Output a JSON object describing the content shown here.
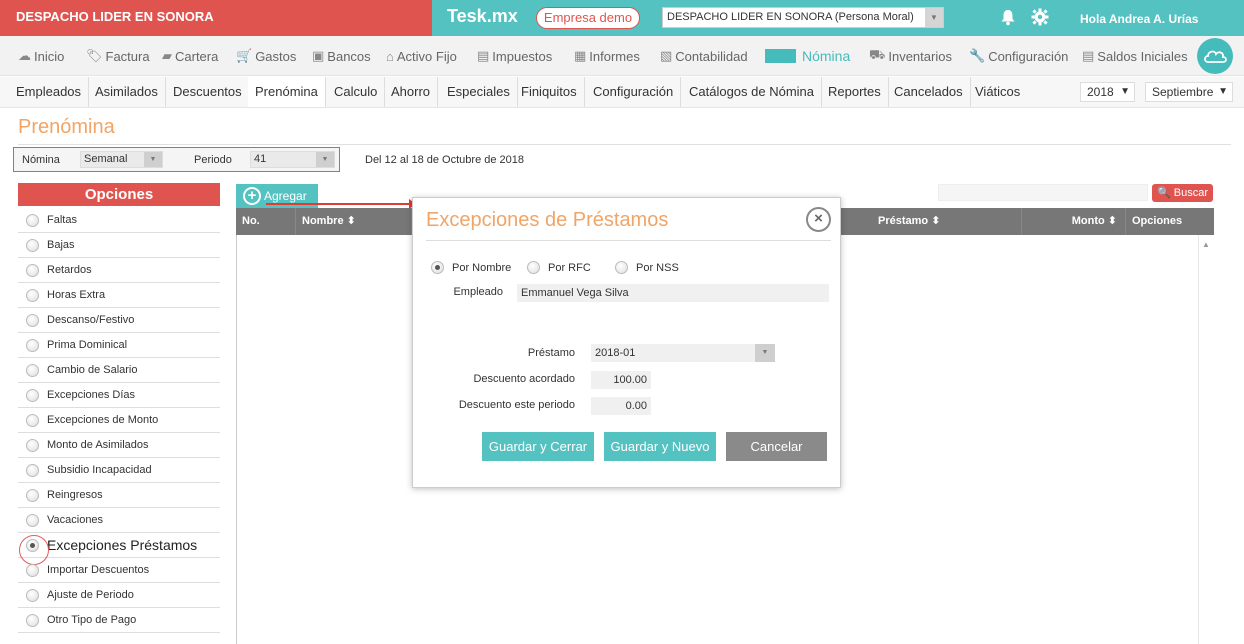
{
  "topbar": {
    "company": "DESPACHO LIDER EN SONORA",
    "brand": "Tesk.mx",
    "demo_badge": "Empresa demo",
    "company_select": "DESPACHO LIDER EN SONORA (Persona Moral)",
    "greeting": "Hola Andrea A. Urías"
  },
  "menu": {
    "items": [
      "Inicio",
      "Factura",
      "Cartera",
      "Gastos",
      "Bancos",
      "Activo Fijo",
      "Impuestos",
      "Informes",
      "Contabilidad",
      "Nómina",
      "Inventarios",
      "Configuración",
      "Saldos Iniciales"
    ],
    "active": "Nómina"
  },
  "subnav": {
    "items": [
      "Empleados",
      "Asimilados",
      "Descuentos",
      "Prenómina",
      "Calculo",
      "Ahorro",
      "Especiales",
      "Finiquitos",
      "Configuración",
      "Catálogos de Nómina",
      "Reportes",
      "Cancelados",
      "Viáticos"
    ],
    "active": "Prenómina",
    "year": "2018",
    "month": "Septiembre"
  },
  "page": {
    "title": "Prenómina",
    "nomina_label": "Nómina",
    "nomina_value": "Semanal",
    "periodo_label": "Periodo",
    "periodo_value": "41",
    "period_range": "Del 12 al 18 de Octubre de 2018"
  },
  "options": {
    "header": "Opciones",
    "items": [
      "Faltas",
      "Bajas",
      "Retardos",
      "Horas Extra",
      "Descanso/Festivo",
      "Prima Dominical",
      "Cambio de Salario",
      "Excepciones Días",
      "Excepciones de Monto",
      "Monto de Asimilados",
      "Subsidio Incapacidad",
      "Reingresos",
      "Vacaciones",
      "Excepciones Préstamos",
      "Importar Descuentos",
      "Ajuste de Periodo",
      "Otro Tipo de Pago"
    ],
    "selected_index": 13
  },
  "grid": {
    "add_label": "Agregar",
    "search_label": "Buscar",
    "columns": [
      "No.",
      "Nombre",
      "Préstamo",
      "Monto",
      "Opciones"
    ]
  },
  "modal": {
    "title": "Excepciones de Préstamos",
    "radio_options": [
      "Por Nombre",
      "Por RFC",
      "Por NSS"
    ],
    "radio_selected": "Por Nombre",
    "empleado_label": "Empleado",
    "empleado_value": "Emmanuel Vega Silva",
    "prestamo_label": "Préstamo",
    "prestamo_value": "2018-01",
    "descuento_acordado_label": "Descuento acordado",
    "descuento_acordado_value": "100.00",
    "descuento_periodo_label": "Descuento este periodo",
    "descuento_periodo_value": "0.00",
    "btn_save_close": "Guardar y Cerrar",
    "btn_save_new": "Guardar y Nuevo",
    "btn_cancel": "Cancelar"
  },
  "colors": {
    "brand_red": "#e0544f",
    "brand_teal": "#54c2c1",
    "title_orange": "#f0a566",
    "cancel_gray": "#8a8a8a"
  }
}
